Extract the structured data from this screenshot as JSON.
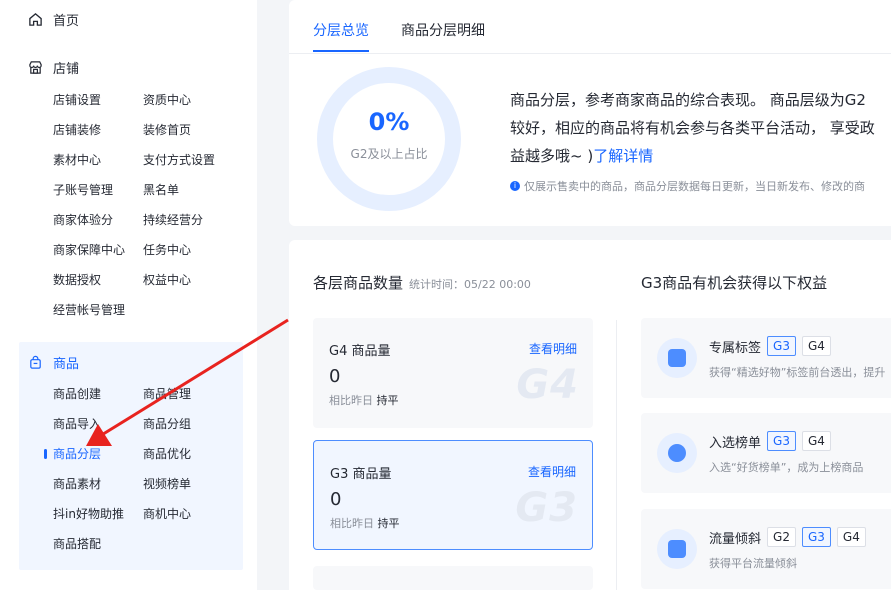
{
  "sidebar": {
    "home": "首页",
    "shop": {
      "title": "店铺",
      "items": [
        "店铺设置",
        "资质中心",
        "店铺装修",
        "装修首页",
        "素材中心",
        "支付方式设置",
        "子账号管理",
        "黑名单",
        "商家体验分",
        "持续经营分",
        "商家保障中心",
        "任务中心",
        "数据授权",
        "权益中心",
        "经营帐号管理"
      ]
    },
    "goods": {
      "title": "商品",
      "items": [
        "商品创建",
        "商品管理",
        "商品导入",
        "商品分组",
        "商品分层",
        "商品优化",
        "商品素材",
        "视频榜单",
        "抖in好物助推",
        "商机中心",
        "商品搭配"
      ]
    }
  },
  "tabs": [
    "分层总览",
    "商品分层明细"
  ],
  "overview": {
    "ring_value": "0%",
    "ring_label": "G2及以上占比",
    "desc_line1": "商品分层，参考商家商品的综合表现。 商品层级为G2",
    "desc_line2": "较好，相应的商品将有机会参与各类平台活动， 享受政",
    "desc_line3": "益越多哦~ )",
    "desc_link": "了解详情",
    "note": "仅展示售卖中的商品，商品分层数据每日更新，当日新发布、修改的商"
  },
  "counts": {
    "title": "各层商品数量",
    "stat_time": "统计时间：05/22 00:00",
    "cards": [
      {
        "title": "G4 商品量",
        "link": "查看明细",
        "value": "0",
        "cmp_label": "相比昨日",
        "cmp_value": "持平",
        "bg": "G4"
      },
      {
        "title": "G3 商品量",
        "link": "查看明细",
        "value": "0",
        "cmp_label": "相比昨日",
        "cmp_value": "持平",
        "bg": "G3"
      }
    ]
  },
  "benefits": {
    "title": "G3商品有机会获得以下权益",
    "items": [
      {
        "name": "专属标签",
        "tags": [
          "G3",
          "G4"
        ],
        "desc": "获得“精选好物”标签前台透出，提升"
      },
      {
        "name": "入选榜单",
        "tags": [
          "G3",
          "G4"
        ],
        "desc": "入选“好货榜单”，成为上榜商品"
      },
      {
        "name": "流量倾斜",
        "tags": [
          "G2",
          "G3",
          "G4"
        ],
        "desc": "获得平台流量倾斜"
      }
    ]
  },
  "colors": {
    "accent": "#1966ff",
    "arrow": "#e8231f"
  }
}
